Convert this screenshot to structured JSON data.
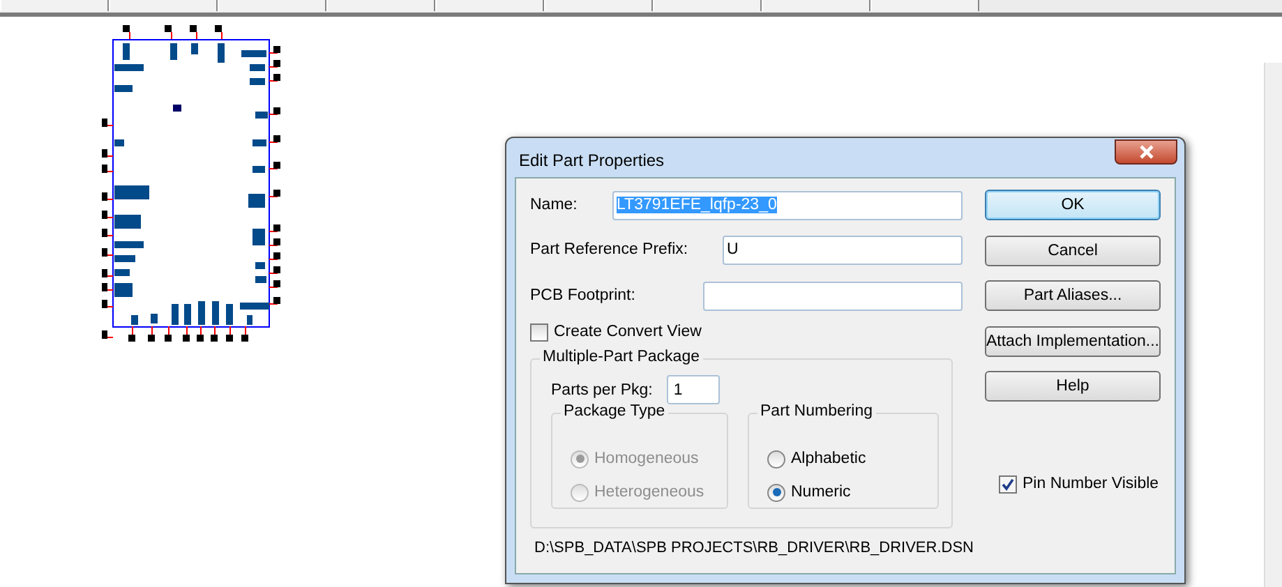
{
  "dialog": {
    "title": "Edit Part Properties",
    "fields": [
      {
        "label": "Name:",
        "value": "LT3791EFE_lqfp-23_0",
        "highlighted": true
      },
      {
        "label": "Part Reference Prefix:",
        "value": "U",
        "highlighted": false
      },
      {
        "label": "PCB Footprint:"
      }
    ],
    "convert_view": {
      "label": "Create Convert View",
      "checked": false
    },
    "package_group": {
      "title": "Multiple-Part Package",
      "parts_label": "Parts per Pkg:",
      "parts_value": "1",
      "package_type": {
        "title": "Package Type",
        "options": [
          {
            "label": "Homogeneous",
            "selected": true,
            "disabled": true
          },
          {
            "label": "Heterogeneous",
            "selected": false,
            "disabled": true
          }
        ]
      },
      "part_numbering": {
        "title": "Part Numbering",
        "options": [
          {
            "label": "Alphabetic",
            "selected": false,
            "disabled": false
          },
          {
            "label": "Numeric",
            "selected": true,
            "disabled": false
          }
        ]
      }
    },
    "path": "D:\\SPB_DATA\\SPB PROJECTS\\RB_DRIVER\\RB_DRIVER.DSN",
    "buttons": [
      {
        "label": "OK",
        "default": true
      },
      {
        "label": "Cancel",
        "default": false
      },
      {
        "label": "Part Aliases...",
        "default": false
      },
      {
        "label": "Attach Implementation...",
        "default": false
      },
      {
        "label": "Help",
        "default": false
      }
    ],
    "pin_number_visible": {
      "label": "Pin Number Visible",
      "checked": true
    }
  }
}
